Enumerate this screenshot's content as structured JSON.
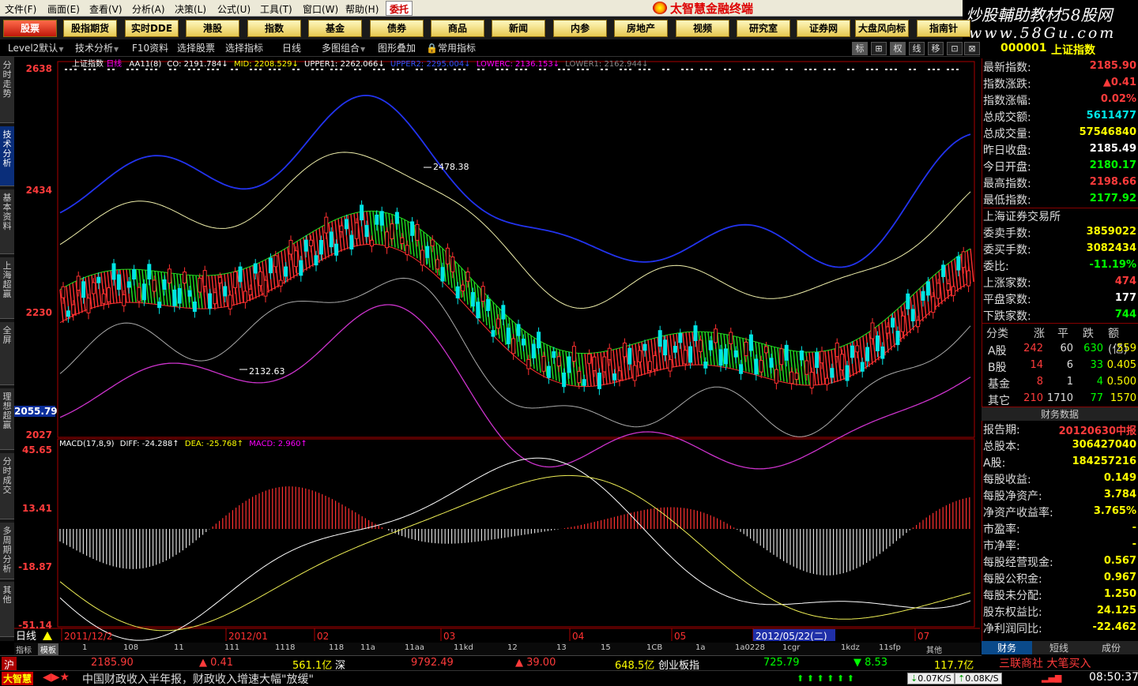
{
  "menu": [
    "文件(F)",
    "画面(E)",
    "查看(V)",
    "分析(A)",
    "决策(L)",
    "公式(U)",
    "工具(T)",
    "窗口(W)",
    "帮助(H)"
  ],
  "entrust": "委托",
  "brand": "太智慧金融终端",
  "watermark": {
    "line1": "炒股輔助教材58股网",
    "line2": "www.58Gu.com"
  },
  "categories": [
    "股票",
    "股指期货",
    "实时DDE",
    "港股",
    "指数",
    "基金",
    "债券",
    "商品",
    "新闻",
    "内参",
    "房地产",
    "视频",
    "研究室",
    "证券网",
    "大盘风向标",
    "指南针"
  ],
  "toolbar": [
    "Level2默认",
    "技术分析",
    "F10资料",
    "选择股票",
    "选择指标",
    "日线",
    "多图组合",
    "图形叠加",
    "常用指标"
  ],
  "toolbar_icons": [
    "标",
    "⊞",
    "权",
    "线",
    "移",
    "⊡",
    "⊠"
  ],
  "leftnav": [
    "分时走势",
    "技术分析",
    "基本资料",
    "上海超赢",
    "全屏",
    "理想超赢",
    "分时成交",
    "多周期分析",
    "其他"
  ],
  "chart": {
    "legend": {
      "name": "上证指数",
      "period": "日线",
      "indicator": "AA11(8)",
      "co": "CO: 2191.784↓",
      "mid": "MID: 2208.529↓",
      "upper1": "UPPER1: 2262.066↓",
      "upper2": "UPPER2: 2295.004↓",
      "lowerc": "LOWERC: 2136.153↓",
      "lower1": "LOWER1: 2162.944↓"
    },
    "price_axis": [
      "2638",
      "2434",
      "2230",
      "2055.79",
      "2027"
    ],
    "macd_axis": [
      "45.65",
      "13.41",
      "-18.87",
      "-51.14"
    ],
    "annotations": {
      "high": "2478.38",
      "low": "2132.63"
    },
    "macd_legend": {
      "name": "MACD(17,8,9)",
      "diff": "DIFF: -24.288↑",
      "dea": "DEA: -25.768↑",
      "macd": "MACD: 2.960↑"
    },
    "date_axis": [
      "2011/12/2",
      "2012/01",
      "02",
      "03",
      "04",
      "05",
      "2012/05/22(二)",
      "07"
    ],
    "period_label": "日线"
  },
  "subtabs": [
    "指标",
    "模板",
    "1",
    "108",
    "11",
    "111",
    "1118",
    "118",
    "11a",
    "11aa",
    "11kd",
    "12",
    "13",
    "15",
    "1CB",
    "1a",
    "1a0228",
    "1cgr",
    "1kdz",
    "11sfp",
    "其他"
  ],
  "sidebar": {
    "code": "000001",
    "name": "上证指数",
    "quote": [
      {
        "label": "最新指数:",
        "value": "2185.90",
        "color": "#ff3b3b"
      },
      {
        "label": "指数涨跌:",
        "value": "▲0.41",
        "color": "#ff3b3b"
      },
      {
        "label": "指数涨幅:",
        "value": "0.02%",
        "color": "#ff3b3b"
      },
      {
        "label": "总成交额:",
        "value": "5611477",
        "color": "#00e6e6"
      },
      {
        "label": "总成交量:",
        "value": "57546840",
        "color": "#ffff00"
      },
      {
        "label": "昨日收盘:",
        "value": "2185.49",
        "color": "#ffffff"
      },
      {
        "label": "今日开盘:",
        "value": "2180.17",
        "color": "#00ff00"
      },
      {
        "label": "最高指数:",
        "value": "2198.66",
        "color": "#ff3b3b"
      },
      {
        "label": "最低指数:",
        "value": "2177.92",
        "color": "#00ff00"
      }
    ],
    "exchange": "上海证券交易所",
    "market": [
      {
        "label": "委卖手数:",
        "value": "3859022",
        "color": "#ffff00"
      },
      {
        "label": "委买手数:",
        "value": "3082434",
        "color": "#ffff00"
      },
      {
        "label": "委比:",
        "value": "-11.19%",
        "color": "#00ff00"
      },
      {
        "label": "上涨家数:",
        "value": "474",
        "color": "#ff3b3b"
      },
      {
        "label": "平盘家数:",
        "value": "177",
        "color": "#ffffff"
      },
      {
        "label": "下跌家数:",
        "value": "744",
        "color": "#00ff00"
      }
    ],
    "table": {
      "headers": [
        "分类",
        "涨",
        "平",
        "跌",
        "额(亿)"
      ],
      "rows": [
        [
          "A股",
          "242",
          "60",
          "630",
          "559"
        ],
        [
          "B股",
          "14",
          "6",
          "33",
          "0.405"
        ],
        [
          "基金",
          "8",
          "1",
          "4",
          "0.500"
        ],
        [
          "其它",
          "210",
          "1710",
          "77",
          "1570"
        ]
      ]
    },
    "finance_title": "财务数据",
    "finance": [
      {
        "label": "报告期:",
        "value": "20120630中报",
        "color": "#ff3b3b"
      },
      {
        "label": "总股本:",
        "value": "306427040",
        "color": "#ffff00"
      },
      {
        "label": "A股:",
        "value": "184257216",
        "color": "#ffff00"
      },
      {
        "label": "每股收益:",
        "value": "0.149",
        "color": "#ffff00"
      },
      {
        "label": "每股净资产:",
        "value": "3.784",
        "color": "#ffff00"
      },
      {
        "label": "净资产收益率:",
        "value": "3.765%",
        "color": "#ffff00"
      },
      {
        "label": "市盈率:",
        "value": "-",
        "color": "#ffff00"
      },
      {
        "label": "市净率:",
        "value": "-",
        "color": "#ffff00"
      },
      {
        "label": "每股经营现金:",
        "value": "0.567",
        "color": "#ffff00"
      },
      {
        "label": "每股公积金:",
        "value": "0.967",
        "color": "#ffff00"
      },
      {
        "label": "每股未分配:",
        "value": "1.250",
        "color": "#ffff00"
      },
      {
        "label": "股东权益比:",
        "value": "24.125",
        "color": "#ffff00"
      },
      {
        "label": "净利润同比:",
        "value": "-22.462",
        "color": "#ffff00"
      }
    ],
    "bottom_tabs": [
      "财务",
      "短线",
      "成份"
    ]
  },
  "statusbar": {
    "sh_label": "沪",
    "sh_price": "2185.90",
    "sh_change": "▲ 0.41",
    "sh_amount": "561.1亿",
    "sz_label": "深",
    "sz_price": "9792.49",
    "sz_change": "▲ 39.00",
    "sz_amount": "648.5亿",
    "cyb_label": "创业板指",
    "cyb_price": "725.79",
    "cyb_change": "▼ 8.53",
    "cyb_amount": "117.7亿"
  },
  "news": {
    "logo": "大智慧",
    "headline": "中国财政收入半年报，财政收入增速大幅\"放缓\"",
    "ticker": "三联商社 大笔买入",
    "speed1": "0.07K/S",
    "speed2": "0.08K/S",
    "time": "08:50:37"
  }
}
